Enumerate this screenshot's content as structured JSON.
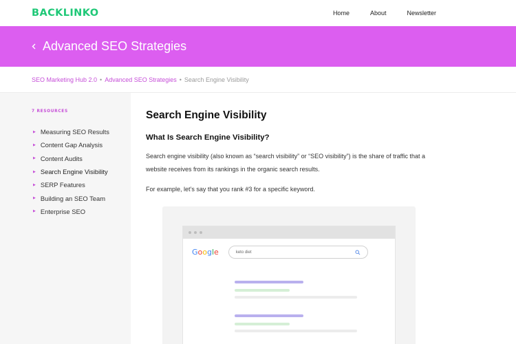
{
  "brand": {
    "logo_text": "BACKLINKO"
  },
  "nav": {
    "items": [
      "Home",
      "About",
      "Newsletter"
    ]
  },
  "hero": {
    "back_icon": "chevron-left-icon",
    "title": "Advanced SEO Strategies"
  },
  "breadcrumb": {
    "items": [
      "SEO Marketing Hub 2.0",
      "Advanced SEO Strategies",
      "Search Engine Visibility"
    ],
    "separator": "•"
  },
  "sidebar": {
    "count_label": "7 RESOURCES",
    "items": [
      {
        "label": "Measuring SEO Results"
      },
      {
        "label": "Content Gap Analysis"
      },
      {
        "label": "Content Audits"
      },
      {
        "label": "Search Engine Visibility",
        "active": true
      },
      {
        "label": "SERP Features"
      },
      {
        "label": "Building an SEO Team"
      },
      {
        "label": "Enterprise SEO"
      }
    ]
  },
  "article": {
    "title": "Search Engine Visibility",
    "heading": "What Is Search Engine Visibility?",
    "paragraphs": [
      "Search engine visibility (also known as “search visibility” or “SEO visibility”) is the share of traffic that a website receives from its rankings in the organic search results.",
      "For example, let’s say that you rank #3 for a specific keyword."
    ]
  },
  "illustration": {
    "search_engine_logo": "Google",
    "search_query": "keto diet",
    "search_icon": "magnifier-icon"
  },
  "colors": {
    "brand_green": "#1fc877",
    "accent_purple": "#dc5ef0",
    "link_purple": "#c64fd8",
    "result_title": "#b9b0ee",
    "result_url": "#d5efd6",
    "result_text": "#ececec"
  }
}
